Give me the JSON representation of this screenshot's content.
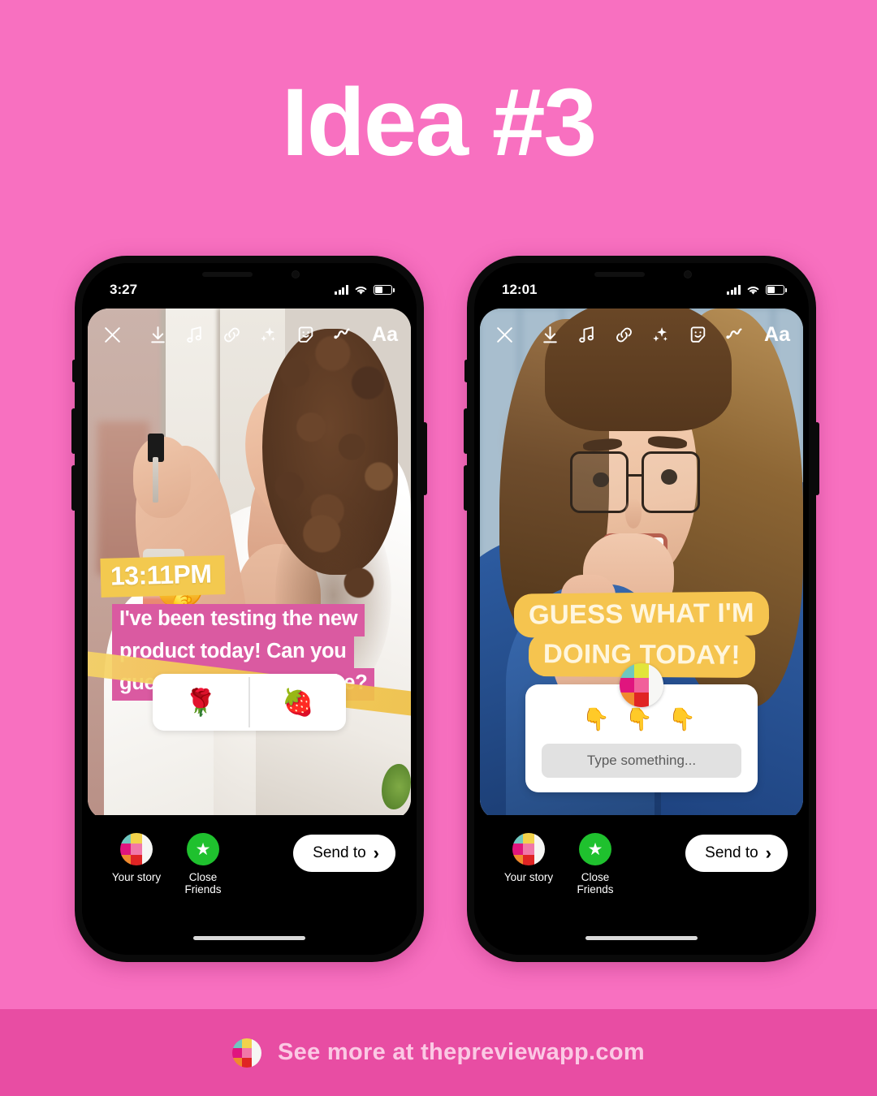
{
  "page": {
    "title": "Idea #3",
    "background_color": "#F870C0",
    "footer_color": "#E84DA3"
  },
  "footer": {
    "text": "See more at thepreviewapp.com",
    "logo_icon": "preview-app-grid-logo"
  },
  "toolbar": {
    "items": [
      {
        "icon": "close-icon",
        "label": "Close"
      },
      {
        "icon": "download-icon",
        "label": "Save"
      },
      {
        "icon": "music-icon",
        "label": "Music"
      },
      {
        "icon": "link-icon",
        "label": "Link"
      },
      {
        "icon": "sparkles-icon",
        "label": "Effects"
      },
      {
        "icon": "sticker-icon",
        "label": "Stickers"
      },
      {
        "icon": "draw-icon",
        "label": "Draw"
      },
      {
        "icon": "text-icon",
        "label": "Aa"
      }
    ]
  },
  "share_bar": {
    "your_story_label": "Your story",
    "close_friends_label": "Close Friends",
    "send_to_label": "Send to",
    "chevron": "›",
    "close_friends_color": "#1FC12E"
  },
  "phones": [
    {
      "status": {
        "time": "3:27",
        "signal": "signal-icon",
        "wifi": "wifi-icon",
        "battery": "battery-icon"
      },
      "story": {
        "time_sticker": {
          "text": "13:11PM",
          "highlight_color": "#F3C94F",
          "text_color": "#FFFFFF"
        },
        "caption": {
          "lines": [
            "I've been testing the new",
            "product today! Can you",
            "guess what it smells like?"
          ],
          "highlight_color": "#DA5AA1",
          "text_color": "#FFFFFF"
        },
        "emoji_sticker": "🤫",
        "poll": {
          "option_left": "🌹",
          "option_right": "🍓"
        },
        "brush_color": "#F3C94F"
      }
    },
    {
      "status": {
        "time": "12:01",
        "signal": "signal-icon",
        "wifi": "wifi-icon",
        "battery": "battery-icon"
      },
      "story": {
        "headline": {
          "lines": [
            "GUESS WHAT I'M",
            "DOING TODAY!"
          ],
          "highlight_color": "#F5C44F",
          "text_color": "#FFF6DE"
        },
        "question_sticker": {
          "avatar_icon": "preview-app-grid-avatar",
          "emoji_row": "👇 👇 👇",
          "input_placeholder": "Type something..."
        }
      }
    }
  ]
}
